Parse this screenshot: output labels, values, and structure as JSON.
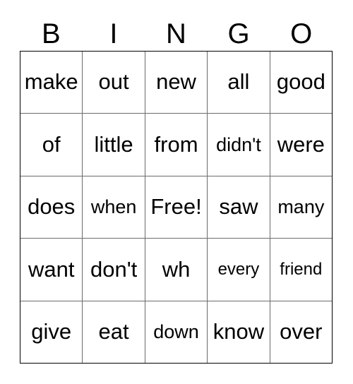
{
  "card": {
    "title": "BINGO",
    "headers": [
      "B",
      "I",
      "N",
      "G",
      "O"
    ],
    "free_space_label": "Free!",
    "colors": {
      "background": "#ffffff",
      "text": "#000000",
      "outer_border": "#000000",
      "grid_line": "#6b6b6b"
    },
    "rows": [
      [
        {
          "word": "make",
          "fit": "normal"
        },
        {
          "word": "out",
          "fit": "normal"
        },
        {
          "word": "new",
          "fit": "normal"
        },
        {
          "word": "all",
          "fit": "normal"
        },
        {
          "word": "good",
          "fit": "normal"
        }
      ],
      [
        {
          "word": "of",
          "fit": "normal"
        },
        {
          "word": "little",
          "fit": "normal"
        },
        {
          "word": "from",
          "fit": "normal"
        },
        {
          "word": "didn't",
          "fit": "small"
        },
        {
          "word": "were",
          "fit": "normal"
        }
      ],
      [
        {
          "word": "does",
          "fit": "normal"
        },
        {
          "word": "when",
          "fit": "small"
        },
        {
          "word": "Free!",
          "fit": "normal"
        },
        {
          "word": "saw",
          "fit": "normal"
        },
        {
          "word": "many",
          "fit": "small"
        }
      ],
      [
        {
          "word": "want",
          "fit": "normal"
        },
        {
          "word": "don't",
          "fit": "normal"
        },
        {
          "word": "wh",
          "fit": "normal"
        },
        {
          "word": "every",
          "fit": "xsmall"
        },
        {
          "word": "friend",
          "fit": "xsmall"
        }
      ],
      [
        {
          "word": "give",
          "fit": "normal"
        },
        {
          "word": "eat",
          "fit": "normal"
        },
        {
          "word": "down",
          "fit": "small"
        },
        {
          "word": "know",
          "fit": "normal"
        },
        {
          "word": "over",
          "fit": "normal"
        }
      ]
    ]
  }
}
